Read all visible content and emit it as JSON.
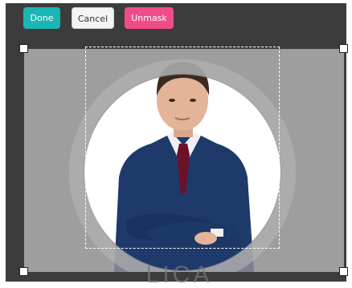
{
  "toolbar": {
    "done_label": "Done",
    "cancel_label": "Cancel",
    "unmask_label": "Unmask"
  },
  "watermark_text": "LICA",
  "colors": {
    "done": "#1bb5b5",
    "cancel": "#f4f4f4",
    "unmask": "#f04c89",
    "stage": "#3c3c3c",
    "dimmed_canvas": "#9e9e9e"
  },
  "icons": [
    "corner-handle-icon"
  ]
}
